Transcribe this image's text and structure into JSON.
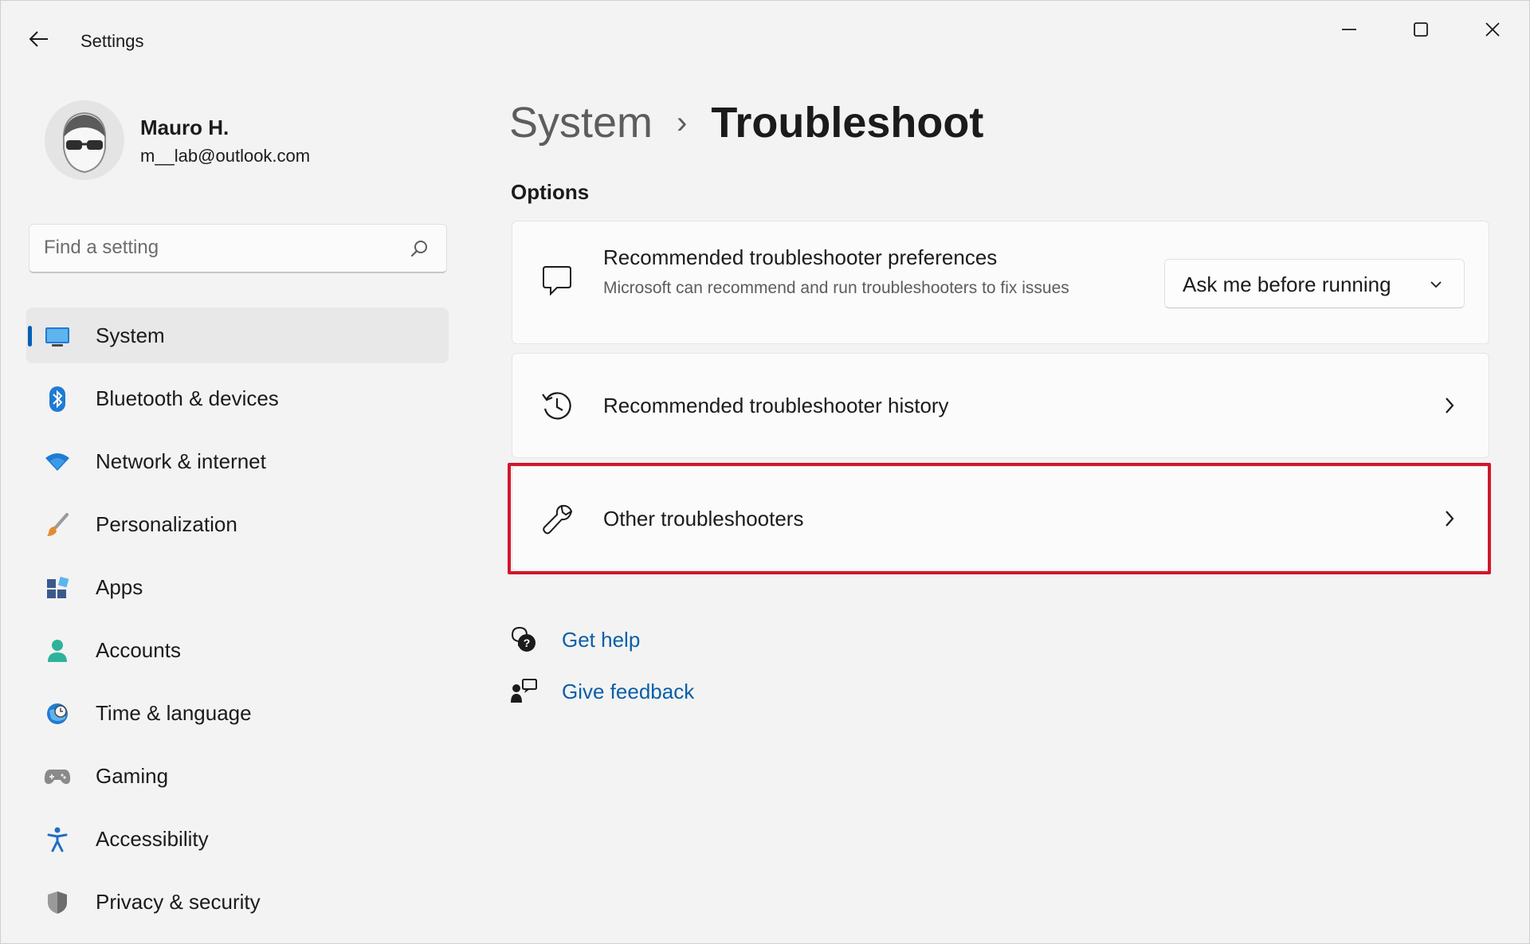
{
  "window": {
    "title": "Settings",
    "controls": [
      "minimize",
      "maximize",
      "close"
    ]
  },
  "profile": {
    "name": "Mauro H.",
    "email": "m__lab@outlook.com"
  },
  "search": {
    "placeholder": "Find a setting",
    "value": ""
  },
  "sidebar": {
    "items": [
      {
        "label": "System",
        "icon": "monitor-icon",
        "active": true
      },
      {
        "label": "Bluetooth & devices",
        "icon": "bluetooth-icon"
      },
      {
        "label": "Network & internet",
        "icon": "wifi-icon"
      },
      {
        "label": "Personalization",
        "icon": "brush-icon"
      },
      {
        "label": "Apps",
        "icon": "apps-icon"
      },
      {
        "label": "Accounts",
        "icon": "person-icon"
      },
      {
        "label": "Time & language",
        "icon": "globe-clock-icon"
      },
      {
        "label": "Gaming",
        "icon": "gamepad-icon"
      },
      {
        "label": "Accessibility",
        "icon": "accessibility-icon"
      },
      {
        "label": "Privacy & security",
        "icon": "shield-icon"
      }
    ]
  },
  "breadcrumb": {
    "parent": "System",
    "separator": "›",
    "current": "Troubleshoot"
  },
  "options": {
    "heading": "Options",
    "cards": [
      {
        "title": "Recommended troubleshooter preferences",
        "description": "Microsoft can recommend and run troubleshooters to fix issues",
        "icon": "chat-bubble-icon",
        "control": {
          "type": "dropdown",
          "value": "Ask me before running"
        }
      },
      {
        "title": "Recommended troubleshooter history",
        "icon": "history-icon"
      },
      {
        "title": "Other troubleshooters",
        "icon": "wrench-icon",
        "highlighted": true
      }
    ]
  },
  "links": {
    "get_help": "Get help",
    "give_feedback": "Give feedback"
  },
  "colors": {
    "accent": "#005fb8",
    "link": "#0a5fa8",
    "highlight_border": "#d3162b",
    "background": "#f3f3f3",
    "card": "#fbfbfb"
  }
}
